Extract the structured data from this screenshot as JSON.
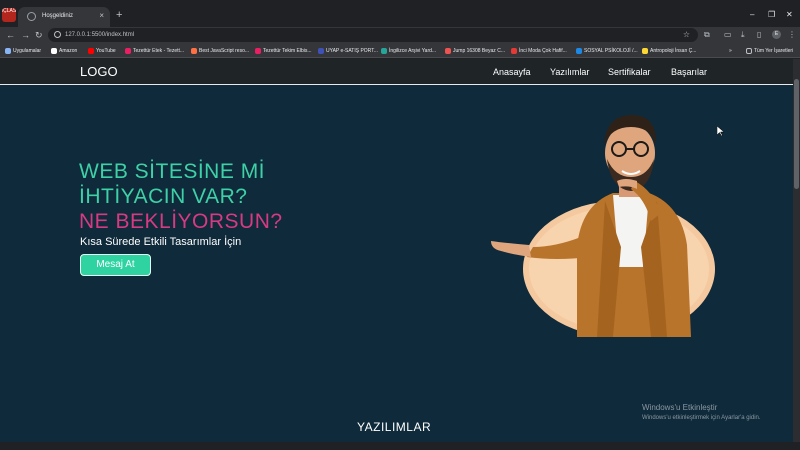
{
  "browser": {
    "profile_chip": "iÇLAS",
    "tab_title": "Hoşgeldiniz",
    "tab_close": "×",
    "new_tab": "+",
    "window_controls": [
      "–",
      "❐",
      "✕"
    ],
    "url": "127.0.0.1:5500/index.html",
    "avatar_letter": "E",
    "bookmarks": [
      {
        "label": "Uygulamalar",
        "color": "#8ab4f8"
      },
      {
        "label": "Amazon",
        "color": "#ffffff"
      },
      {
        "label": "YouTube",
        "color": "#ff0000"
      },
      {
        "label": "Tezettür Etek - Tezett...",
        "color": "#e91e63"
      },
      {
        "label": "Best JavaScript reso...",
        "color": "#ff7043"
      },
      {
        "label": "Tezettür Tekim Elbis...",
        "color": "#e91e63"
      },
      {
        "label": "UYAP e-SATIŞ PORT...",
        "color": "#3f51b5"
      },
      {
        "label": "İngilizce Arşivi Yard...",
        "color": "#26a69a"
      },
      {
        "label": "Jump 16308 Beyaz C...",
        "color": "#ef5350"
      },
      {
        "label": "İnci Moda Çok Hafif...",
        "color": "#e53935"
      },
      {
        "label": "SOSYAL PSİKOLOJİ /...",
        "color": "#1e88e5"
      },
      {
        "label": "Antropoloji İnsan Ç...",
        "color": "#fdd835"
      }
    ],
    "all_bookmarks": "Tüm Yer İşaretleri"
  },
  "site": {
    "logo": "LOGO",
    "nav": [
      "Anasayfa",
      "Yazılımlar",
      "Sertifikalar",
      "Başarılar"
    ],
    "hero": {
      "line1": "WEB SİTESİNE Mİ",
      "line2": "İHTİYACIN VAR?",
      "line3": "NE BEKLİYORSUN?",
      "subtitle": "Kısa Sürede Etkili Tasarımlar İçin",
      "button": "Mesaj At"
    },
    "section_title": "YAZILIMLAR"
  },
  "watermark": {
    "title": "Windows'u Etkinleştir",
    "subtitle": "Windows'u etkinleştirmek için Ayarlar'a gidin."
  },
  "colors": {
    "page_bg": "#0f2a3a",
    "accent_green": "#3ed1a7",
    "accent_pink": "#d63a83",
    "navbar_bg": "#1f2427"
  }
}
